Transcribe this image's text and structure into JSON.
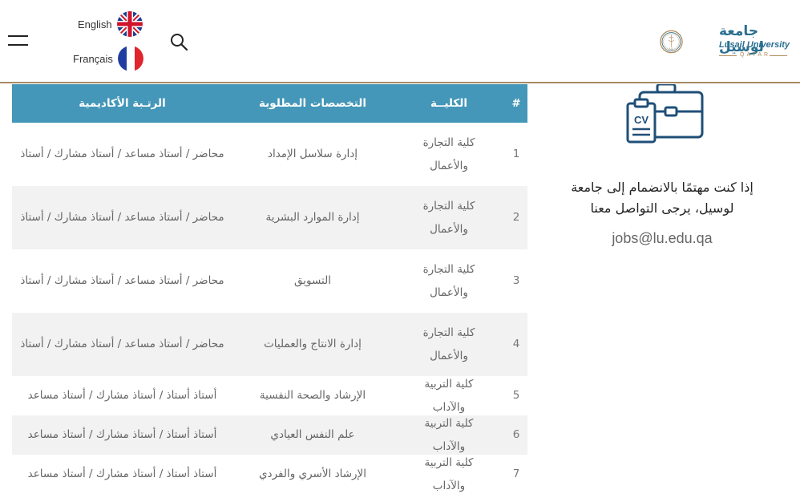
{
  "header": {
    "languages": [
      {
        "label": "English",
        "icon": "uk-flag-icon"
      },
      {
        "label": "Français",
        "icon": "france-flag-icon"
      }
    ],
    "logo": {
      "arabic": "جامعة لوسيل",
      "english": "Lusail University",
      "country": "QATAR"
    },
    "accent_color": "#a88a66"
  },
  "table": {
    "header_color": "#4497b8",
    "columns": [
      "#",
      "الكليــة",
      "التخصصات المطلوبة",
      "الرتـبة الأكاديمية"
    ],
    "rows": [
      {
        "num": "1",
        "college": "كلية التجارة والأعمال",
        "specialty": "إدارة سلاسل الإمداد",
        "rank": "محاضر / أستاذ مساعد / أستاذ مشارك / أستاذ"
      },
      {
        "num": "2",
        "college": "كلية التجارة والأعمال",
        "specialty": "إدارة الموارد البشرية",
        "rank": "محاضر / أستاذ مساعد / أستاذ مشارك / أستاذ"
      },
      {
        "num": "3",
        "college": "كلية التجارة والأعمال",
        "specialty": "التسويق",
        "rank": "محاضر / أستاذ مساعد / أستاذ مشارك / أستاذ"
      },
      {
        "num": "4",
        "college": "كلية التجارة والأعمال",
        "specialty": "إدارة الانتاج والعمليات",
        "rank": "محاضر / أستاذ مساعد / أستاذ مشارك / أستاذ"
      },
      {
        "num": "5",
        "college": "كلية التربية والآداب",
        "specialty": "الإرشاد والصحة النفسية",
        "rank": "أستاذ أستاذ / أستاذ مشارك / أستاذ مساعد"
      },
      {
        "num": "6",
        "college": "كلية التربية والآداب",
        "specialty": "علم النفس العيادي",
        "rank": "أستاذ أستاذ / أستاذ مشارك / أستاذ مساعد"
      },
      {
        "num": "7",
        "college": "كلية التربية والآداب",
        "specialty": "الإرشاد الأسري والفردي",
        "rank": "أستاذ أستاذ / أستاذ مشارك / أستاذ مساعد"
      }
    ]
  },
  "contact": {
    "icon": "cv-briefcase-icon",
    "text": "إذا كنت مهتمًا بالانضمام إلى جامعة لوسيل، يرجى التواصل معنا",
    "email": "jobs@lu.edu.qa"
  }
}
